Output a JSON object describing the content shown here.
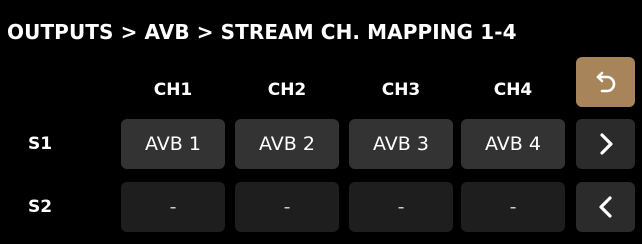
{
  "header": {
    "breadcrumb": "OUTPUTS > AVB > STREAM CH. MAPPING 1-4"
  },
  "columns": [
    "CH1",
    "CH2",
    "CH3",
    "CH4"
  ],
  "rows": [
    {
      "label": "S1",
      "cells": [
        "AVB 1",
        "AVB 2",
        "AVB 3",
        "AVB 4"
      ]
    },
    {
      "label": "S2",
      "cells": [
        "-",
        "-",
        "-",
        "-"
      ]
    }
  ],
  "buttons": {
    "back": {
      "icon": "undo-arrow-icon",
      "color": "#a8845a"
    },
    "next": {
      "icon": "chevron-right-icon"
    },
    "prev": {
      "icon": "chevron-left-icon"
    }
  },
  "colors": {
    "background": "#000000",
    "cell_assigned": "#333333",
    "cell_empty": "#1e1e1e",
    "accent": "#a8845a"
  }
}
